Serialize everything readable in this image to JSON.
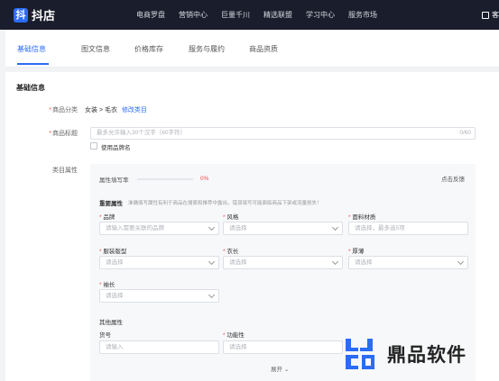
{
  "app": {
    "logo_char": "抖",
    "logo_text": "抖店"
  },
  "topnav": [
    "电商罗盘",
    "营销中心",
    "巨量千川",
    "精选联盟",
    "学习中心",
    "服务市场"
  ],
  "top_right": "客",
  "tabs": [
    "基础信息",
    "图文信息",
    "价格库存",
    "服务与履约",
    "商品资质"
  ],
  "active_tab": 0,
  "section": {
    "title": "基础信息"
  },
  "category": {
    "label": "商品分类",
    "value": "女装 > 毛衣",
    "edit_link": "修改类目"
  },
  "title_field": {
    "label": "商品标题",
    "placeholder": "最多允许输入30个汉字（60字符）",
    "counter": "0/60",
    "brand_checkbox": "使用品牌名"
  },
  "attributes": {
    "label": "类目属性",
    "fill_rate_label": "属性填写率",
    "fill_rate": "0%",
    "feedback": "点击反馈",
    "important_title": "重要属性",
    "important_tip": "准确填写属性有利于商品在搜索和推荐中露出，错误填写可能面临商品下架或流量损失！",
    "fields": [
      {
        "label": "品牌",
        "placeholder": "请输入需要关联的品牌"
      },
      {
        "label": "风格",
        "placeholder": "请选择"
      },
      {
        "label": "面料材质",
        "placeholder": "请选择，最多选5项"
      },
      {
        "label": "服装版型",
        "placeholder": "请选择"
      },
      {
        "label": "衣长",
        "placeholder": "请选择"
      },
      {
        "label": "厚薄",
        "placeholder": "请选择"
      },
      {
        "label": "袖长",
        "placeholder": "请选择"
      }
    ],
    "other_title": "其他属性",
    "other_fields": [
      {
        "label": "货号",
        "placeholder": "请输入"
      },
      {
        "label": "功能性",
        "placeholder": "请选择"
      }
    ],
    "expand": "展开"
  },
  "watermark": {
    "text": "鼎品软件"
  },
  "colors": {
    "accent": "#2c6cf5",
    "required": "#f54a45",
    "topbar": "#1a1d2b"
  }
}
